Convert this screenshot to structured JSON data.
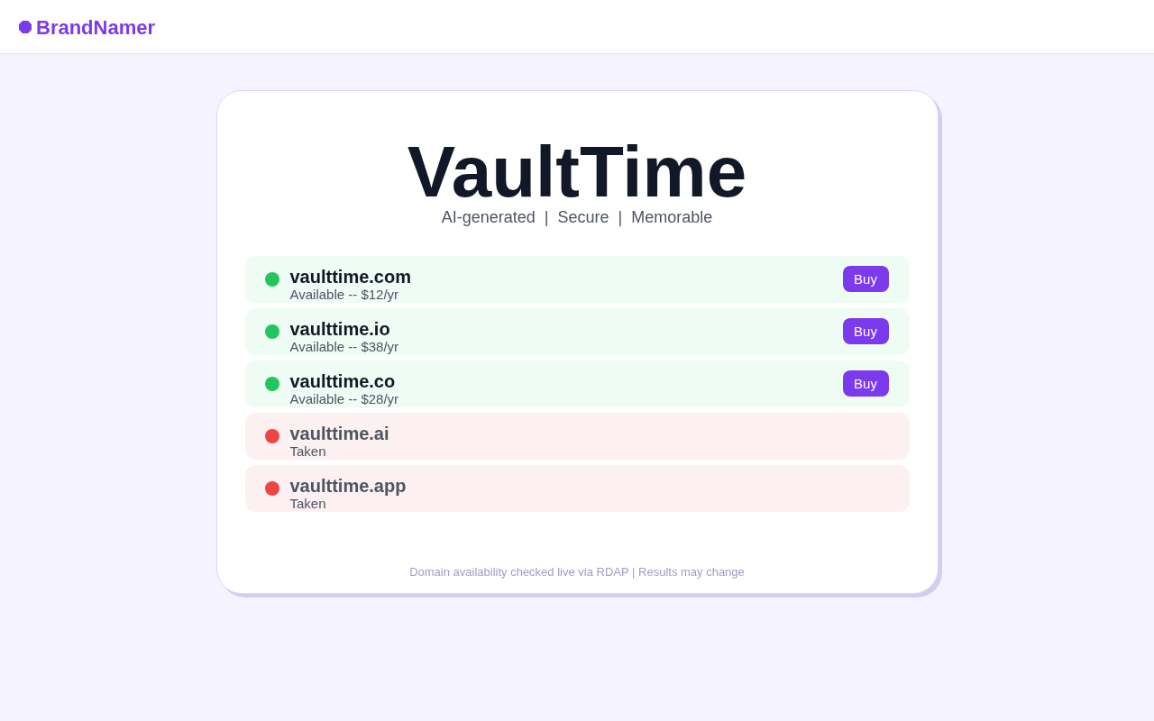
{
  "header": {
    "brand": "BrandNamer"
  },
  "hero": {
    "name": "VaultTime",
    "tagline": "AI-generated | Secure | Memorable"
  },
  "domains": [
    {
      "name": "vaulttime.com",
      "status": "Available -- $12/yr",
      "available": true,
      "color": "#22c55e",
      "action": "Buy"
    },
    {
      "name": "vaulttime.io",
      "status": "Available -- $38/yr",
      "available": true,
      "color": "#22c55e",
      "action": "Buy"
    },
    {
      "name": "vaulttime.co",
      "status": "Available -- $28/yr",
      "available": true,
      "color": "#22c55e",
      "action": "Buy"
    },
    {
      "name": "vaulttime.ai",
      "status": "Taken",
      "available": false,
      "color": "#ef4444"
    },
    {
      "name": "vaulttime.app",
      "status": "Taken",
      "available": false,
      "color": "#ef4444"
    }
  ],
  "footer": "Domain availability checked live via RDAP | Results may change"
}
